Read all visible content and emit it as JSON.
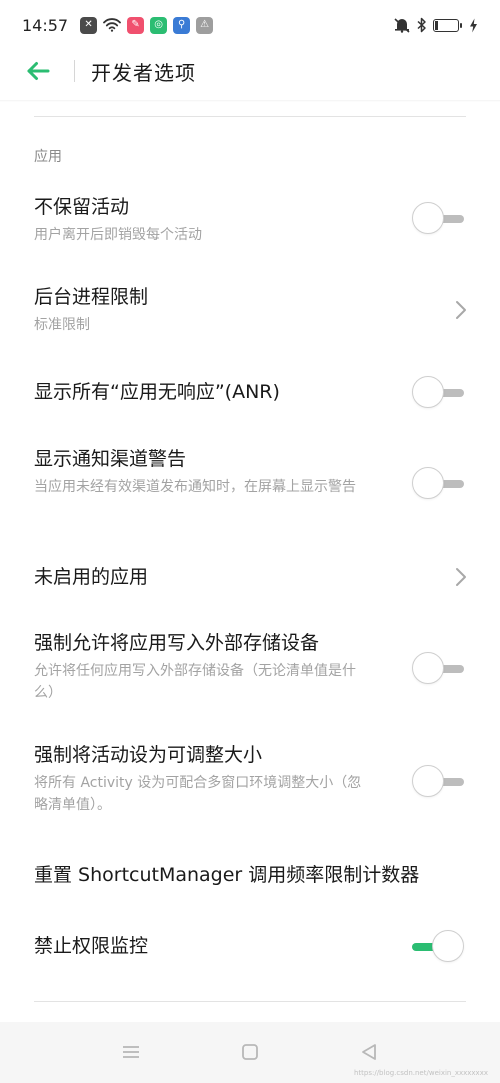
{
  "status_bar": {
    "time": "14:57",
    "notification_icons": [
      {
        "name": "close-notification-icon",
        "color": "#4a4a4a",
        "glyph": "✕"
      },
      {
        "name": "wifi-icon"
      },
      {
        "name": "app-notification-icon",
        "color": "#f0506e",
        "glyph": "✎"
      },
      {
        "name": "wechat-icon",
        "color": "#2bbd72",
        "glyph": "◎"
      },
      {
        "name": "usb-icon",
        "color": "#3a7bd5",
        "glyph": "⚲"
      },
      {
        "name": "debug-icon",
        "color": "#9e9e9e",
        "glyph": "⚠"
      }
    ],
    "right_icons": [
      "mute-icon",
      "bluetooth-icon",
      "battery-icon",
      "charging-icon"
    ]
  },
  "header": {
    "title": "开发者选项",
    "accent_color": "#2bbd72"
  },
  "section": {
    "label": "应用"
  },
  "settings": [
    {
      "title": "不保留活动",
      "subtitle": "用户离开后即销毁每个活动",
      "control": "switch",
      "checked": false
    },
    {
      "title": "后台进程限制",
      "subtitle": "标准限制",
      "control": "chevron"
    },
    {
      "title": "显示所有“应用无响应”(ANR)",
      "subtitle": "",
      "control": "switch",
      "checked": false
    },
    {
      "title": "显示通知渠道警告",
      "subtitle": "当应用未经有效渠道发布通知时，在屏幕上显示警告",
      "control": "switch",
      "checked": false
    },
    {
      "title": "未启用的应用",
      "subtitle": "",
      "control": "chevron"
    },
    {
      "title": "强制允许将应用写入外部存储设备",
      "subtitle": "允许将任何应用写入外部存储设备（无论清单值是什么）",
      "control": "switch",
      "checked": false
    },
    {
      "title": "强制将活动设为可调整大小",
      "subtitle": "将所有 Activity 设为可配合多窗口环境调整大小（忽略清单值）。",
      "control": "switch",
      "checked": false
    },
    {
      "title": "重置 ShortcutManager 调用频率限制计数器",
      "subtitle": "",
      "control": "none"
    },
    {
      "title": "禁止权限监控",
      "subtitle": "",
      "control": "switch",
      "checked": true
    }
  ],
  "nav_bar": {
    "buttons": [
      "menu-icon",
      "home-icon",
      "back-triangle-icon"
    ]
  },
  "watermark": "https://blog.csdn.net/weixin_xxxxxxxx"
}
